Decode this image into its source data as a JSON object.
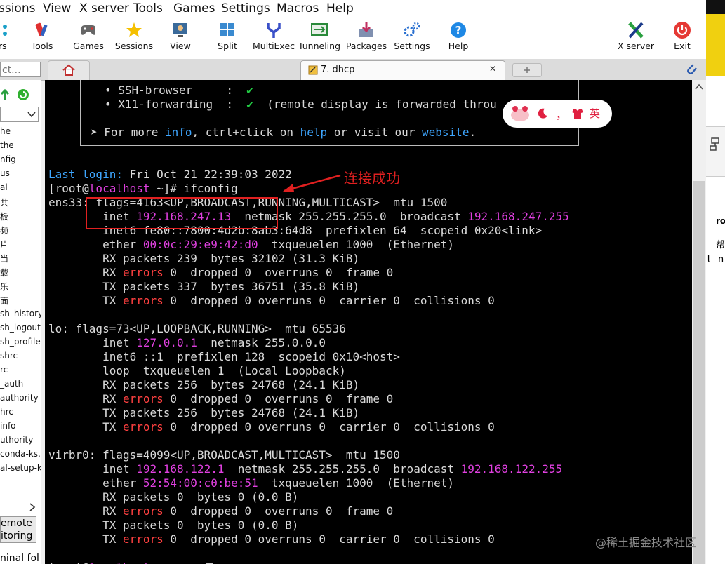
{
  "menubar": {
    "items": [
      "ssions",
      "View",
      "X server",
      "Tools",
      "Games",
      "Settings",
      "Macros",
      "Help"
    ]
  },
  "toolbar": {
    "items": [
      {
        "label": "ers",
        "icon": "servers-icon"
      },
      {
        "label": "Tools",
        "icon": "tools-icon"
      },
      {
        "label": "Games",
        "icon": "games-icon"
      },
      {
        "label": "Sessions",
        "icon": "sessions-star-icon"
      },
      {
        "label": "View",
        "icon": "view-icon"
      },
      {
        "label": "Split",
        "icon": "split-icon"
      },
      {
        "label": "MultiExec",
        "icon": "multiexec-icon"
      },
      {
        "label": "Tunneling",
        "icon": "tunneling-icon"
      },
      {
        "label": "Packages",
        "icon": "packages-icon"
      },
      {
        "label": "Settings",
        "icon": "settings-gears-icon"
      },
      {
        "label": "Help",
        "icon": "help-icon"
      },
      {
        "label": "X server",
        "icon": "xserver-icon"
      },
      {
        "label": "Exit",
        "icon": "exit-power-icon"
      }
    ]
  },
  "tabs": {
    "quick_connect_placeholder": "ct...",
    "active_tab_label": "7. dhcp",
    "close_glyph": "✕"
  },
  "sidebar": {
    "items": [
      "he",
      "the",
      "nfig",
      "us",
      "al",
      "共",
      "板",
      "频",
      "片",
      "当",
      "载",
      "乐",
      "面",
      "sh_history",
      "sh_logout",
      "sh_profile",
      "shrc",
      "rc",
      "_auth",
      "authority",
      "hrc",
      "info",
      "uthority",
      "conda-ks.c",
      "al-setup-k"
    ],
    "remote_line1": "emote",
    "remote_line2": "itoring",
    "bottom_text": "ninal fol"
  },
  "terminal": {
    "motd": {
      "ssh_browser": "• SSH-browser     :  ",
      "x11_forwarding": "• X11-forwarding  :  ",
      "x11_note": "  (remote display is forwarded throu",
      "check": "✔",
      "more_prefix": "➤ For more ",
      "info": "info",
      "more_mid": ", ctrl+click on ",
      "help": "help",
      "more_mid2": " or visit our ",
      "website": "website",
      "more_end": "."
    },
    "last_login_label": "Last login:",
    "last_login_value": " Fri Oct 21 22:39:03 2022",
    "prompt_user": "[root@",
    "prompt_host": "localhost",
    "prompt_rest": " ~]# ifconfig",
    "ens33": {
      "l1": "ens33: flags=4163<UP,BROADCAST,RUNNING,MULTICAST>  mtu 1500",
      "inet_label": "        inet ",
      "inet_ip": "192.168.247.13",
      "inet_mid": "  netmask 255.255.255.0  broadcast ",
      "inet_bcast": "192.168.247.255",
      "l3": "        inet6 fe80::7800:4d2b:8ab3:64d8  prefixlen 64  scopeid 0x20<link>",
      "ether_label": "        ether ",
      "ether_mac": "00:0c:29:e9:42:d0",
      "ether_rest": "  txqueuelen 1000  (Ethernet)",
      "rx_packets": "        RX packets 239  bytes 32102 (31.3 KiB)",
      "rx_err_rest": " 0  dropped 0  overruns 0  frame 0",
      "tx_packets": "        TX packets 337  bytes 36751 (35.8 KiB)",
      "tx_err_rest": " 0  dropped 0 overruns 0  carrier 0  collisions 0"
    },
    "lo": {
      "l1": "lo: flags=73<UP,LOOPBACK,RUNNING>  mtu 65536",
      "inet_label": "        inet ",
      "inet_ip": "127.0.0.1",
      "inet_rest": "  netmask 255.0.0.0",
      "l3": "        inet6 ::1  prefixlen 128  scopeid 0x10<host>",
      "l4": "        loop  txqueuelen 1  (Local Loopback)",
      "rx_packets": "        RX packets 256  bytes 24768 (24.1 KiB)",
      "rx_err_rest": " 0  dropped 0  overruns 0  frame 0",
      "tx_packets": "        TX packets 256  bytes 24768 (24.1 KiB)",
      "tx_err_rest": " 0  dropped 0 overruns 0  carrier 0  collisions 0"
    },
    "virbr0": {
      "l1": "virbr0: flags=4099<UP,BROADCAST,MULTICAST>  mtu 1500",
      "inet_label": "        inet ",
      "inet_ip": "192.168.122.1",
      "inet_mid": "  netmask 255.255.255.0  broadcast ",
      "inet_bcast": "192.168.122.255",
      "ether_label": "        ether ",
      "ether_mac": "52:54:00:c0:be:51",
      "ether_rest": "  txqueuelen 1000  (Ethernet)",
      "rx_packets": "        RX packets 0  bytes 0 (0.0 B)",
      "rx_err_rest": " 0  dropped 0  overruns 0  frame 0",
      "tx_packets": "        TX packets 0  bytes 0 (0.0 B)",
      "tx_err_rest": " 0  dropped 0 overruns 0  carrier 0  collisions 0"
    },
    "errors_word": "errors",
    "rx_prefix": "        RX ",
    "tx_prefix": "        TX "
  },
  "annotation": {
    "text": "连接成功"
  },
  "ime": {
    "text": "，",
    "lang": "英"
  },
  "right_window": {
    "t1": "ro",
    "t2": "帮",
    "t3": "t n"
  },
  "watermark": "@稀土掘金技术社区",
  "colors": {
    "terminal_bg": "#000000",
    "prompt_blue": "#3ea6ff",
    "ip_magenta": "#e040e0",
    "errors_red": "#ff4040",
    "check_green": "#22cc44",
    "annotation_red": "#e02020"
  }
}
